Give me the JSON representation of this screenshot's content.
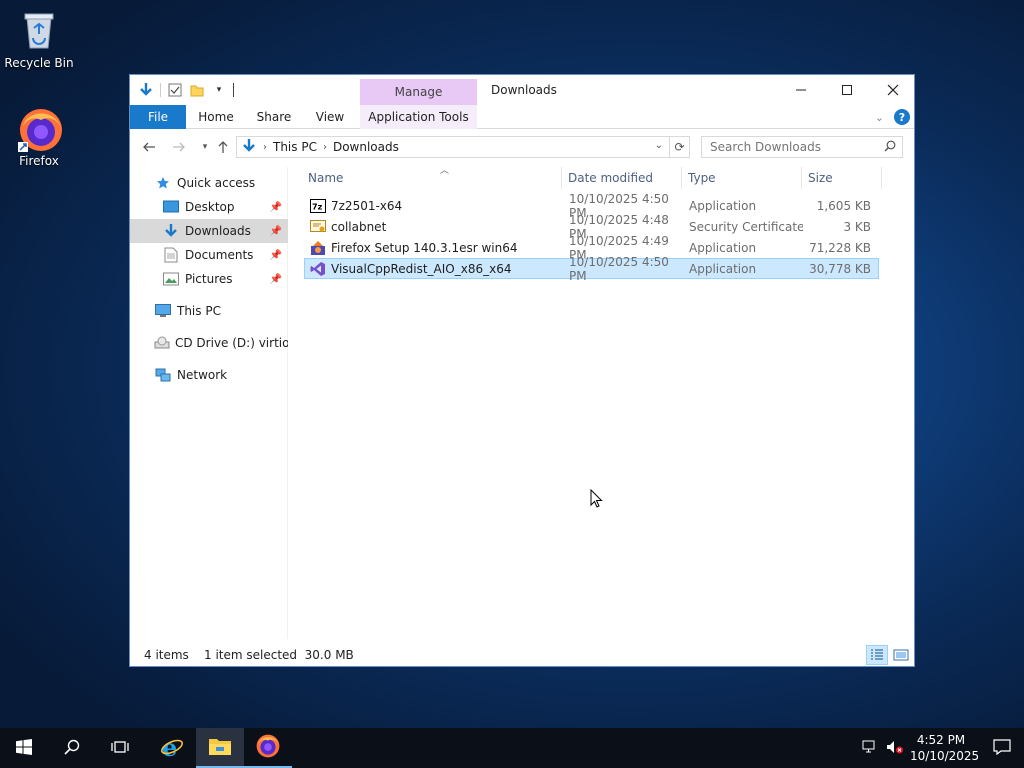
{
  "desktop": {
    "icons": [
      {
        "label": "Recycle Bin",
        "icon": "recycle-bin-icon"
      },
      {
        "label": "Firefox",
        "icon": "firefox-icon"
      }
    ]
  },
  "window": {
    "title": "Downloads",
    "context_tab": "Manage",
    "ribbon_tabs": {
      "file": "File",
      "home": "Home",
      "share": "Share",
      "view": "View",
      "app_tools": "Application Tools"
    },
    "address": {
      "segments": [
        "This PC",
        "Downloads"
      ]
    },
    "search_placeholder": "Search Downloads",
    "colors": {
      "accent": "#1979ca",
      "selection": "#cce8ff",
      "manage_tab": "#e8c9f6"
    }
  },
  "nav": {
    "quick_access": "Quick access",
    "desktop": "Desktop",
    "downloads": "Downloads",
    "documents": "Documents",
    "pictures": "Pictures",
    "this_pc": "This PC",
    "cd_drive": "CD Drive (D:) virtio-w",
    "network": "Network"
  },
  "columns": {
    "name": "Name",
    "date": "Date modified",
    "type": "Type",
    "size": "Size"
  },
  "files": [
    {
      "name": "7z2501-x64",
      "date": "10/10/2025 4:50 PM",
      "type": "Application",
      "size": "1,605 KB",
      "icon": "7zip-icon"
    },
    {
      "name": "collabnet",
      "date": "10/10/2025 4:48 PM",
      "type": "Security Certificate",
      "size": "3 KB",
      "icon": "certificate-icon"
    },
    {
      "name": "Firefox Setup 140.3.1esr win64",
      "date": "10/10/2025 4:49 PM",
      "type": "Application",
      "size": "71,228 KB",
      "icon": "installer-icon"
    },
    {
      "name": "VisualCppRedist_AIO_x86_x64",
      "date": "10/10/2025 4:50 PM",
      "type": "Application",
      "size": "30,778 KB",
      "icon": "visual-studio-icon"
    }
  ],
  "status": {
    "count": "4 items",
    "selection": "1 item selected  30.0 MB"
  },
  "taskbar": {
    "time": "4:52 PM",
    "date": "10/10/2025"
  }
}
